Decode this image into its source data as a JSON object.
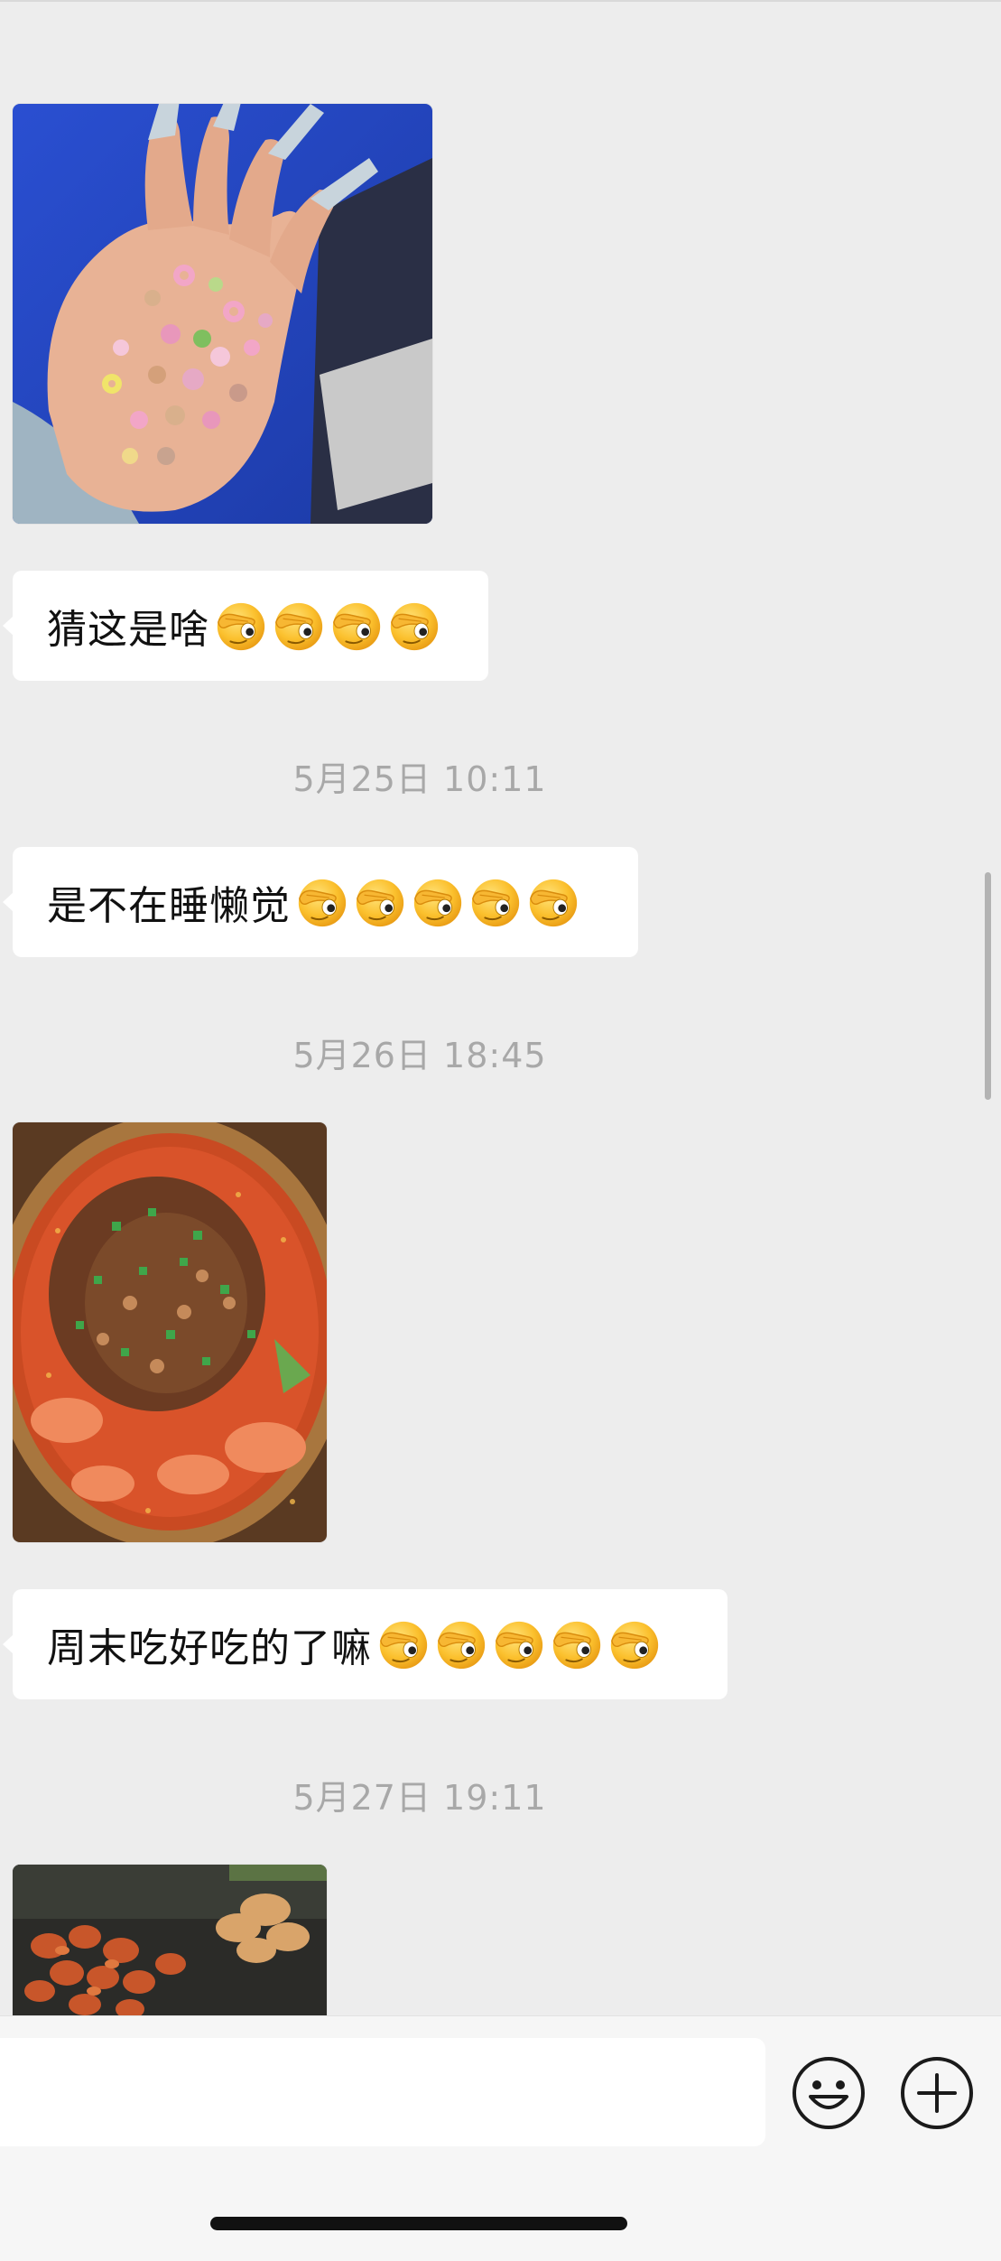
{
  "messages": [
    {
      "type": "image",
      "description": "hand holding beads"
    },
    {
      "type": "text",
      "text": "猜这是啥",
      "emoji_count": 4
    },
    {
      "type": "time",
      "text": "5月25日 10:11"
    },
    {
      "type": "text",
      "text": "是不在睡懒觉",
      "emoji_count": 5
    },
    {
      "type": "time",
      "text": "5月26日 18:45"
    },
    {
      "type": "image",
      "description": "spicy fish dish"
    },
    {
      "type": "text",
      "text": "周末吃好吃的了嘛",
      "emoji_count": 5
    },
    {
      "type": "time",
      "text": "5月27日 19:11"
    },
    {
      "type": "image",
      "description": "fried snacks"
    }
  ],
  "icons": {
    "emoji": "peek-face-emoji",
    "emoji_button": "smiley-face-icon",
    "more_button": "plus-circle-icon"
  },
  "input": {
    "value": ""
  },
  "colors": {
    "background": "#ededed",
    "bubble": "#ffffff",
    "timestamp": "#a8a8a8",
    "input_bar": "#f6f6f6"
  }
}
